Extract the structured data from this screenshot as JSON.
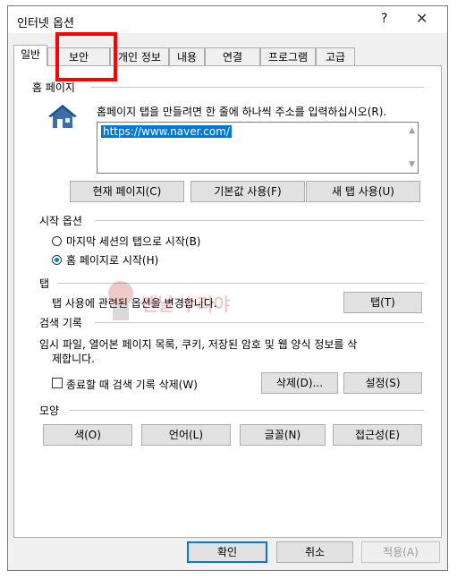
{
  "window": {
    "title": "인터넷 옵션",
    "help": "?",
    "close": "✕"
  },
  "tabs": [
    {
      "label": "일반"
    },
    {
      "label": "보안"
    },
    {
      "label": "개인 정보"
    },
    {
      "label": "내용"
    },
    {
      "label": "연결"
    },
    {
      "label": "프로그램"
    },
    {
      "label": "고급"
    }
  ],
  "home": {
    "group_label": "홈 페이지",
    "instruction": "홈페이지 탭을 만들려면 한 줄에 하나씩 주소를 입력하십시오(R).",
    "url": "https://www.naver.com/",
    "buttons": {
      "current": "현재 페이지(C)",
      "default": "기본값 사용(F)",
      "new_tab": "새 탭 사용(U)"
    }
  },
  "startup": {
    "group_label": "시작 옵션",
    "option1": "마지막 세션의 탭으로 시작(B)",
    "option2": "홈 페이지로 시작(H)",
    "selected": "option2"
  },
  "tabs_group": {
    "group_label": "탭",
    "text": "탭 사용에 관련된 옵션을 변경합니다.",
    "button": "탭(T)"
  },
  "history": {
    "group_label": "검색 기록",
    "text_line1": "임시 파일, 열어본 페이지 목록, 쿠키, 저장된 암호 및 웹 양식 정보를 삭",
    "text_line2": "제합니다.",
    "checkbox": "종료할 때 검색 기록 삭제(W)",
    "delete_button": "삭제(D)...",
    "settings_button": "설정(S)"
  },
  "appearance": {
    "group_label": "모양",
    "colors": "색(O)",
    "languages": "언어(L)",
    "fonts": "글꼴(N)",
    "accessibility": "접근성(E)"
  },
  "footer": {
    "ok": "확인",
    "cancel": "취소",
    "apply": "적용(A)"
  },
  "watermark": {
    "text": "맨날 수리야"
  },
  "colors": {
    "accent": "#0078d7",
    "highlight": "#ff0000",
    "house": "#3a6ea5"
  }
}
